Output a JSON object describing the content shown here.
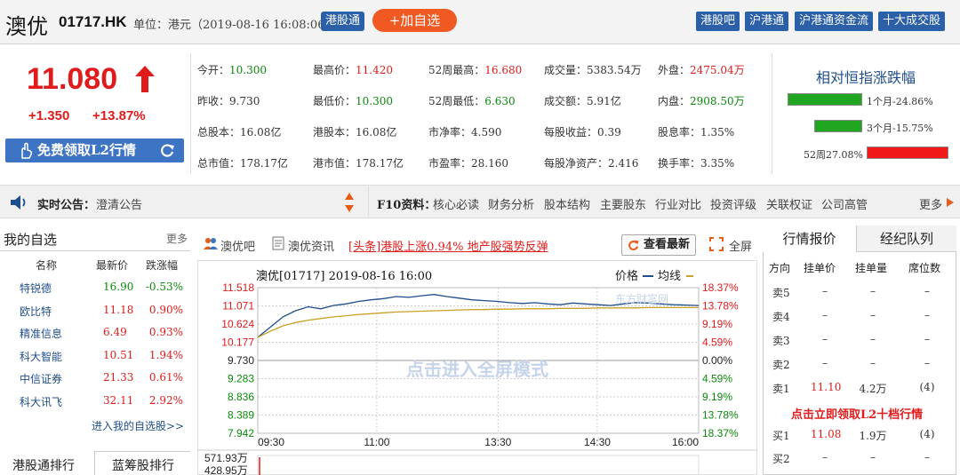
{
  "header": {
    "stock_name": "澳优",
    "stock_code": "01717.HK",
    "unit_text": "单位：港元（2019-08-16 16:08:06）",
    "tag": "港股通",
    "add_watch": "+加自选",
    "links": [
      "港股吧",
      "沪港通",
      "沪港通资金流",
      "十大成交股"
    ]
  },
  "quote": {
    "price": "11.080",
    "change": "+1.350",
    "change_pct": "+13.87%",
    "l2_button": "免费领取L2行情",
    "colors": {
      "up": "#e01b1b",
      "down": "#0a8a0a",
      "link": "#1f4e8c"
    },
    "stats": [
      [
        {
          "l": "今开：",
          "v": "10.300",
          "c": "green"
        },
        {
          "l": "最高价：",
          "v": "11.420",
          "c": "red"
        },
        {
          "l": "52周最高：",
          "v": "16.680",
          "c": "red"
        },
        {
          "l": "成交量：",
          "v": "5383.54万",
          "c": ""
        },
        {
          "l": "外盘：",
          "v": "2475.04万",
          "c": "red"
        }
      ],
      [
        {
          "l": "昨收：",
          "v": "9.730",
          "c": ""
        },
        {
          "l": "最低价：",
          "v": "10.300",
          "c": "green"
        },
        {
          "l": "52周最低：",
          "v": "6.630",
          "c": "green"
        },
        {
          "l": "成交额：",
          "v": "5.91亿",
          "c": ""
        },
        {
          "l": "内盘：",
          "v": "2908.50万",
          "c": "green"
        }
      ],
      [
        {
          "l": "总股本：",
          "v": "16.08亿",
          "c": ""
        },
        {
          "l": "港股本：",
          "v": "16.08亿",
          "c": ""
        },
        {
          "l": "市净率：",
          "v": "4.590",
          "c": ""
        },
        {
          "l": "每股收益：",
          "v": "0.39",
          "c": ""
        },
        {
          "l": "股息率：",
          "v": "1.35%",
          "c": ""
        }
      ],
      [
        {
          "l": "总市值：",
          "v": "178.17亿",
          "c": ""
        },
        {
          "l": "港市值：",
          "v": "178.17亿",
          "c": ""
        },
        {
          "l": "市盈率：",
          "v": "28.160",
          "c": ""
        },
        {
          "l": "每股净资产：",
          "v": "2.416",
          "c": ""
        },
        {
          "l": "换手率：",
          "v": "3.35%",
          "c": ""
        }
      ]
    ]
  },
  "hsi": {
    "title": "相对恒指涨跌幅",
    "bars": [
      {
        "label": "1个月-24.86%",
        "value": -24.86
      },
      {
        "label": "3个月-15.75%",
        "value": -15.75
      },
      {
        "label": "52周27.08%",
        "value": 27.08
      }
    ]
  },
  "notice": {
    "label": "实时公告：",
    "text": "澄清公告",
    "f10_label": "F10资料：",
    "f10_items": [
      "核心必读",
      "财务分析",
      "股本结构",
      "主要股东",
      "行业对比",
      "投资评级",
      "关联权证",
      "公司高管"
    ],
    "f10_more": "更多"
  },
  "watchlist": {
    "title": "我的自选",
    "more": "更多",
    "headers": [
      "名称",
      "最新价",
      "跌涨幅"
    ],
    "rows": [
      {
        "name": "特锐德",
        "price": "16.90",
        "pct": "-0.53%",
        "c": "green"
      },
      {
        "name": "欧比特",
        "price": "11.18",
        "pct": "0.90%",
        "c": "red"
      },
      {
        "name": "精准信息",
        "price": "6.49",
        "pct": "0.93%",
        "c": "red"
      },
      {
        "name": "科大智能",
        "price": "10.51",
        "pct": "1.94%",
        "c": "red"
      },
      {
        "name": "中信证券",
        "price": "21.33",
        "pct": "0.61%",
        "c": "red"
      },
      {
        "name": "科大讯飞",
        "price": "32.11",
        "pct": "2.92%",
        "c": "red"
      }
    ],
    "link": "进入我的自选股>>",
    "bottom_tabs": [
      "港股通排行",
      "蓝筹股排行"
    ]
  },
  "toolbar": {
    "guba": "澳优吧",
    "news": "澳优资讯",
    "headline": "[头条]港股上涨0.94% 地产股强势反弹",
    "refresh": "查看最新",
    "fullscreen": "全屏"
  },
  "chart": {
    "title": "澳优[01717] 2019-08-16 16:00",
    "legend_price": "价格",
    "legend_avg": "均线",
    "watermark_center": "点击进入全屏模式",
    "watermark_logo": "东方财富网",
    "volume_labels": [
      "571.93万",
      "428.95万"
    ]
  },
  "chart_data": {
    "type": "line",
    "y_left_ticks": [
      "11.518",
      "11.071",
      "10.624",
      "10.177",
      "9.730",
      "9.283",
      "8.836",
      "8.389",
      "7.942"
    ],
    "y_right_ticks": [
      "18.37%",
      "13.78%",
      "9.19%",
      "4.59%",
      "0.00%",
      "4.59%",
      "9.19%",
      "13.78%",
      "18.37%"
    ],
    "x_ticks": [
      "09:30",
      "11:00",
      "13:30",
      "14:30",
      "16:00"
    ],
    "ylim": [
      7.942,
      11.518
    ],
    "prev_close": 9.73,
    "series": [
      {
        "name": "价格",
        "color": "#1f4e8c",
        "values": [
          10.3,
          10.55,
          10.8,
          10.95,
          11.05,
          11.0,
          11.08,
          11.12,
          11.18,
          11.22,
          11.25,
          11.3,
          11.28,
          11.32,
          11.35,
          11.3,
          11.26,
          11.22,
          11.2,
          11.18,
          11.15,
          11.13,
          11.15,
          11.12,
          11.1,
          11.14,
          11.12,
          11.1,
          11.08,
          11.12,
          11.15,
          11.14,
          11.12,
          11.1,
          11.09,
          11.08
        ]
      },
      {
        "name": "均线",
        "color": "#c9a227",
        "values": [
          10.3,
          10.45,
          10.58,
          10.66,
          10.72,
          10.76,
          10.8,
          10.83,
          10.86,
          10.88,
          10.9,
          10.92,
          10.93,
          10.94,
          10.95,
          10.96,
          10.97,
          10.98,
          10.98,
          10.99,
          10.99,
          11.0,
          11.0,
          11.0,
          11.01,
          11.01,
          11.01,
          11.02,
          11.02,
          11.02,
          11.02,
          11.03,
          11.03,
          11.03,
          11.03,
          11.03
        ]
      }
    ]
  },
  "orderbook": {
    "tabs": [
      "行情报价",
      "经纪队列"
    ],
    "headers": [
      "方向",
      "挂单价",
      "挂单量",
      "席位数"
    ],
    "asks": [
      {
        "dir": "卖5",
        "price": "–",
        "vol": "–",
        "seats": "–"
      },
      {
        "dir": "卖4",
        "price": "–",
        "vol": "–",
        "seats": "–"
      },
      {
        "dir": "卖3",
        "price": "–",
        "vol": "–",
        "seats": "–"
      },
      {
        "dir": "卖2",
        "price": "–",
        "vol": "–",
        "seats": "–"
      },
      {
        "dir": "卖1",
        "price": "11.10",
        "vol": "4.2万",
        "seats": "(4)"
      }
    ],
    "l2_link": "点击立即领取L2十档行情",
    "bids": [
      {
        "dir": "买1",
        "price": "11.08",
        "vol": "1.9万",
        "seats": "(4)"
      },
      {
        "dir": "买2",
        "price": "–",
        "vol": "–",
        "seats": "–"
      }
    ]
  }
}
